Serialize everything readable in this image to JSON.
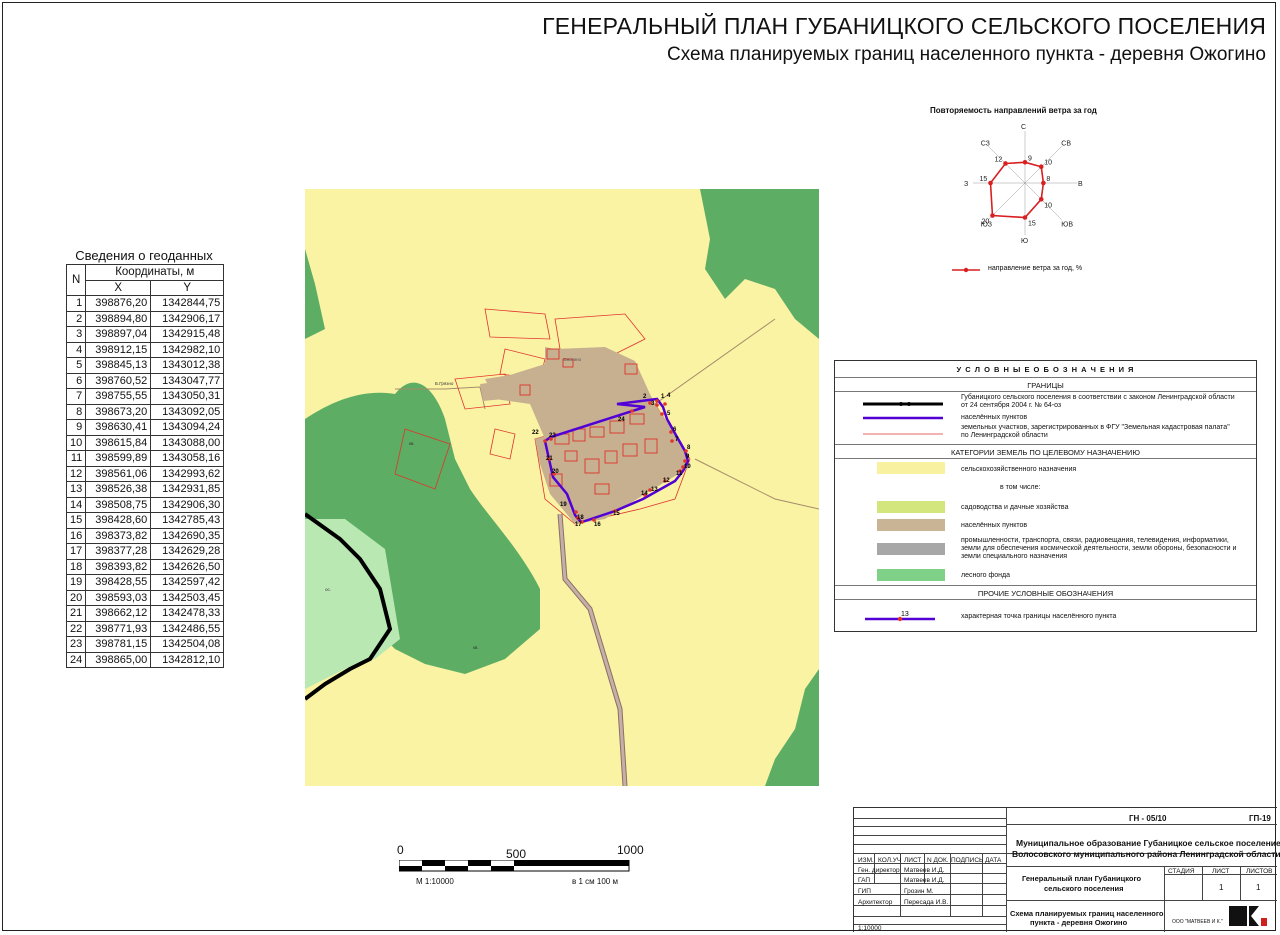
{
  "title": "ГЕНЕРАЛЬНЫЙ ПЛАН ГУБАНИЦКОГО СЕЛЬСКОГО ПОСЕЛЕНИЯ",
  "subtitle": "Схема планируемых границ населенного пункта - деревня Ожогино",
  "geodata": {
    "title": "Сведения о геоданных",
    "col_n": "N",
    "col_coords": "Координаты, м",
    "col_x": "X",
    "col_y": "Y",
    "rows": [
      {
        "n": "1",
        "x": "398876,20",
        "y": "1342844,75"
      },
      {
        "n": "2",
        "x": "398894,80",
        "y": "1342906,17"
      },
      {
        "n": "3",
        "x": "398897,04",
        "y": "1342915,48"
      },
      {
        "n": "4",
        "x": "398912,15",
        "y": "1342982,10"
      },
      {
        "n": "5",
        "x": "398845,13",
        "y": "1343012,38"
      },
      {
        "n": "6",
        "x": "398760,52",
        "y": "1343047,77"
      },
      {
        "n": "7",
        "x": "398755,55",
        "y": "1343050,31"
      },
      {
        "n": "8",
        "x": "398673,20",
        "y": "1343092,05"
      },
      {
        "n": "9",
        "x": "398630,41",
        "y": "1343094,24"
      },
      {
        "n": "10",
        "x": "398615,84",
        "y": "1343088,00"
      },
      {
        "n": "11",
        "x": "398599,89",
        "y": "1343058,16"
      },
      {
        "n": "12",
        "x": "398561,06",
        "y": "1342993,62"
      },
      {
        "n": "13",
        "x": "398526,38",
        "y": "1342931,85"
      },
      {
        "n": "14",
        "x": "398508,75",
        "y": "1342906,30"
      },
      {
        "n": "15",
        "x": "398428,60",
        "y": "1342785,43"
      },
      {
        "n": "16",
        "x": "398373,82",
        "y": "1342690,35"
      },
      {
        "n": "17",
        "x": "398377,28",
        "y": "1342629,28"
      },
      {
        "n": "18",
        "x": "398393,82",
        "y": "1342626,50"
      },
      {
        "n": "19",
        "x": "398428,55",
        "y": "1342597,42"
      },
      {
        "n": "20",
        "x": "398593,03",
        "y": "1342503,45"
      },
      {
        "n": "21",
        "x": "398662,12",
        "y": "1342478,33"
      },
      {
        "n": "22",
        "x": "398771,93",
        "y": "1342486,55"
      },
      {
        "n": "23",
        "x": "398781,15",
        "y": "1342504,08"
      },
      {
        "n": "24",
        "x": "398865,00",
        "y": "1342812,10"
      }
    ]
  },
  "map": {
    "labels": {
      "village": "Ожогино",
      "forest1": "кв.",
      "forest2": "кв.",
      "sub": "ос.",
      "town": "Б.Грязно"
    },
    "point_labels": [
      "1",
      "2",
      "3",
      "4",
      "5",
      "6",
      "7",
      "8",
      "9",
      "10",
      "11",
      "12",
      "13",
      "14",
      "15",
      "16",
      "17",
      "18",
      "19",
      "20",
      "21",
      "22",
      "23",
      "24"
    ],
    "colors": {
      "agri": "#fbf3a4",
      "forest": "#5dae64",
      "light_forest": "#b9e8b3",
      "settlement": "#c6b090",
      "boundary": "#5200d6",
      "parcel": "#e0342c"
    }
  },
  "wind": {
    "title": "Повторяемость направлений ветра за год",
    "directions": [
      "С",
      "СВ",
      "В",
      "ЮВ",
      "Ю",
      "ЮЗ",
      "З",
      "СЗ"
    ],
    "values": [
      9,
      10,
      8,
      10,
      15,
      20,
      15,
      12
    ],
    "value_labels": [
      "9",
      "10",
      "8",
      "10",
      "15",
      "20",
      "15",
      "12"
    ],
    "legend": "направление ветра за год, %",
    "extra_mark": "i",
    "color": "#d91f1f"
  },
  "legend": {
    "title": "У С Л О В Н Ы Е   О Б О З Н А Ч Е Н И Я",
    "section_borders": "ГРАНИЦЫ",
    "b1": "Губаницкого сельского поселения в соответствии с законом Ленинградской области",
    "b1b": "от 24 сентября 2004 г. № 64-оз",
    "b2": "населённых пунктов",
    "b3": "земельных участков, зарегистрированных в ФГУ \"Земельная кадастровая палата\"",
    "b3b": "по Ленинградской области",
    "section_categories": "КАТЕГОРИИ ЗЕМЕЛЬ ПО ЦЕЛЕВОМУ НАЗНАЧЕНИЮ",
    "c1": "сельскохозяйственного назначения",
    "c1b": "в том числе:",
    "c2": "садоводства и дачные хозяйства",
    "c3": "населённых пунктов",
    "c4": "промышленности, транспорта, связи, радиовещания, телевидения, информатики,",
    "c4b": "земли для обеспечения космической деятельности, земли обороны, безопасности и",
    "c4c": "земли специального назначения",
    "c5": "лесного фонда",
    "section_other": "ПРОЧИЕ УСЛОВНЫЕ ОБОЗНАЧЕНИЯ",
    "o1": "характерная точка границы населённого пункта",
    "o1_num": "13",
    "colors": {
      "agri": "#f8f2a0",
      "garden": "#d3e67e",
      "settle": "#c9b596",
      "industry": "#a7a7a7",
      "forest": "#7fd188"
    }
  },
  "scale": {
    "l0": "0",
    "l500": "500",
    "l1000": "1000",
    "ratio": "М 1:10000",
    "per_cm": "в 1 см 100 м"
  },
  "stamp": {
    "code": "ГН - 05/10",
    "sheet_code": "ГП-19",
    "org": "Муниципальное образование Губаницкое сельское поселение",
    "org2": "Волосовского муниципального района Ленинградской области",
    "headers": [
      "ИЗМ.",
      "КОЛ.УЧ",
      "ЛИСТ",
      "N ДОК.",
      "ПОДПИСЬ",
      "ДАТА"
    ],
    "roles": [
      {
        "role": "Ген. директор",
        "name": "Матвеев И.Д."
      },
      {
        "role": "ГАП",
        "name": "Матвеев И.Д."
      },
      {
        "role": "ГИП",
        "name": "Грозин М."
      },
      {
        "role": "Архитектор",
        "name": "Пересада И.В."
      }
    ],
    "project": "Генеральный план Губаницкого",
    "project2": "сельского поселения",
    "stage": "СТАДИЯ",
    "sheet": "ЛИСТ",
    "sheets": "ЛИСТОВ",
    "sheet_val": "1",
    "sheets_val": "1",
    "drawing": "Схема планируемых границ населенного",
    "drawing2": "пункта - деревня Ожогино",
    "company": "ООО \"МАТВЕЕВ И К.\"",
    "scale": "1:10000"
  }
}
